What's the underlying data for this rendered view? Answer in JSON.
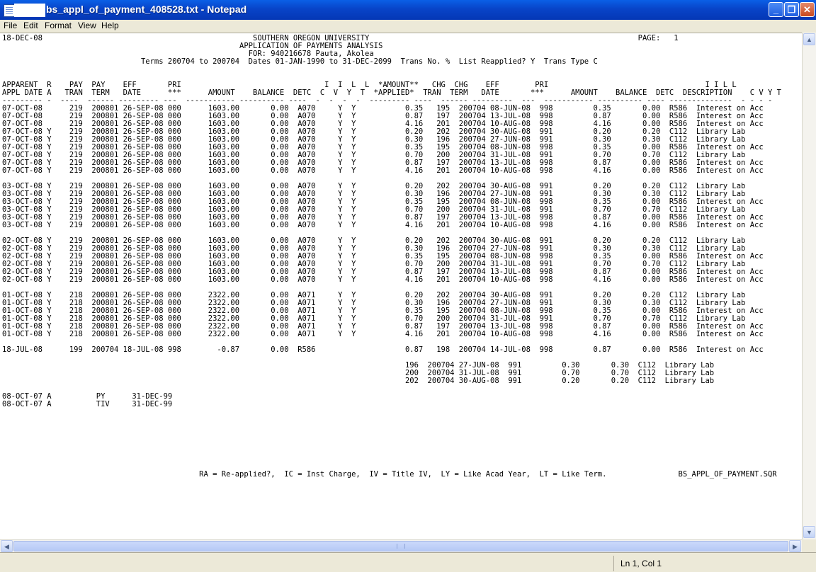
{
  "window": {
    "title": "bs_appl_of_payment_408528.txt - Notepad",
    "minimize_icon": "minimize-icon",
    "maximize_icon": "maximize-icon",
    "close_icon": "close-icon"
  },
  "menu": {
    "file": "File",
    "edit": "Edit",
    "format": "Format",
    "view": "View",
    "help": "Help"
  },
  "document": {
    "lines": [
      "18-DEC-08                                               SOUTHERN OREGON UNIVERSITY                                                            PAGE:   1",
      "                                                     APPLICATION OF PAYMENTS ANALYSIS",
      "                                                       FOR: 940216678 Pauta, Akolea",
      "                               Terms 200704 to 200704  Dates 01-JAN-1990 to 31-DEC-2099  Trans No. %  List Reapplied? Y  Trans Type C",
      "",
      "",
      "APPARENT  R    PAY  PAY    EFF       PRI                                I  I  L  L  *AMOUNT**   CHG  CHG    EFF        PRI                                   I I L L",
      "APPL DATE A   TRAN  TERM   DATE      ***      AMOUNT    BALANCE  DETC  C  V  Y  T  *APPLIED*  TRAN  TERM   DATE       ***      AMOUNT    BALANCE  DETC  DESCRIPTION    C V Y T",
      "--------- -  ----  ------ --------- ---  ----------- ---------- ----  -  -  -  -  --------- ----  ------ ---------  ---  ----------- ---------- ---- --------------  - - - -",
      "07-OCT-08      219  200801 26-SEP-08 000      1603.00       0.00  A070     Y  Y           0.35   195  200704 08-JUN-08  998         0.35       0.00  R586  Interest on Acc",
      "07-OCT-08      219  200801 26-SEP-08 000      1603.00       0.00  A070     Y  Y           0.87   197  200704 13-JUL-08  998         0.87       0.00  R586  Interest on Acc",
      "07-OCT-08      219  200801 26-SEP-08 000      1603.00       0.00  A070     Y  Y           4.16   201  200704 10-AUG-08  998         4.16       0.00  R586  Interest on Acc",
      "07-OCT-08 Y    219  200801 26-SEP-08 000      1603.00       0.00  A070     Y  Y           0.20   202  200704 30-AUG-08  991         0.20       0.20  C112  Library Lab",
      "07-OCT-08 Y    219  200801 26-SEP-08 000      1603.00       0.00  A070     Y  Y           0.30   196  200704 27-JUN-08  991         0.30       0.30  C112  Library Lab",
      "07-OCT-08 Y    219  200801 26-SEP-08 000      1603.00       0.00  A070     Y  Y           0.35   195  200704 08-JUN-08  998         0.35       0.00  R586  Interest on Acc",
      "07-OCT-08 Y    219  200801 26-SEP-08 000      1603.00       0.00  A070     Y  Y           0.70   200  200704 31-JUL-08  991         0.70       0.70  C112  Library Lab",
      "07-OCT-08 Y    219  200801 26-SEP-08 000      1603.00       0.00  A070     Y  Y           0.87   197  200704 13-JUL-08  998         0.87       0.00  R586  Interest on Acc",
      "07-OCT-08 Y    219  200801 26-SEP-08 000      1603.00       0.00  A070     Y  Y           4.16   201  200704 10-AUG-08  998         4.16       0.00  R586  Interest on Acc",
      "",
      "03-OCT-08 Y    219  200801 26-SEP-08 000      1603.00       0.00  A070     Y  Y           0.20   202  200704 30-AUG-08  991         0.20       0.20  C112  Library Lab",
      "03-OCT-08 Y    219  200801 26-SEP-08 000      1603.00       0.00  A070     Y  Y           0.30   196  200704 27-JUN-08  991         0.30       0.30  C112  Library Lab",
      "03-OCT-08 Y    219  200801 26-SEP-08 000      1603.00       0.00  A070     Y  Y           0.35   195  200704 08-JUN-08  998         0.35       0.00  R586  Interest on Acc",
      "03-OCT-08 Y    219  200801 26-SEP-08 000      1603.00       0.00  A070     Y  Y           0.70   200  200704 31-JUL-08  991         0.70       0.70  C112  Library Lab",
      "03-OCT-08 Y    219  200801 26-SEP-08 000      1603.00       0.00  A070     Y  Y           0.87   197  200704 13-JUL-08  998         0.87       0.00  R586  Interest on Acc",
      "03-OCT-08 Y    219  200801 26-SEP-08 000      1603.00       0.00  A070     Y  Y           4.16   201  200704 10-AUG-08  998         4.16       0.00  R586  Interest on Acc",
      "",
      "02-OCT-08 Y    219  200801 26-SEP-08 000      1603.00       0.00  A070     Y  Y           0.20   202  200704 30-AUG-08  991         0.20       0.20  C112  Library Lab",
      "02-OCT-08 Y    219  200801 26-SEP-08 000      1603.00       0.00  A070     Y  Y           0.30   196  200704 27-JUN-08  991         0.30       0.30  C112  Library Lab",
      "02-OCT-08 Y    219  200801 26-SEP-08 000      1603.00       0.00  A070     Y  Y           0.35   195  200704 08-JUN-08  998         0.35       0.00  R586  Interest on Acc",
      "02-OCT-08 Y    219  200801 26-SEP-08 000      1603.00       0.00  A070     Y  Y           0.70   200  200704 31-JUL-08  991         0.70       0.70  C112  Library Lab",
      "02-OCT-08 Y    219  200801 26-SEP-08 000      1603.00       0.00  A070     Y  Y           0.87   197  200704 13-JUL-08  998         0.87       0.00  R586  Interest on Acc",
      "02-OCT-08 Y    219  200801 26-SEP-08 000      1603.00       0.00  A070     Y  Y           4.16   201  200704 10-AUG-08  998         4.16       0.00  R586  Interest on Acc",
      "",
      "01-OCT-08 Y    218  200801 26-SEP-08 000      2322.00       0.00  A071     Y  Y           0.20   202  200704 30-AUG-08  991         0.20       0.20  C112  Library Lab",
      "01-OCT-08 Y    218  200801 26-SEP-08 000      2322.00       0.00  A071     Y  Y           0.30   196  200704 27-JUN-08  991         0.30       0.30  C112  Library Lab",
      "01-OCT-08 Y    218  200801 26-SEP-08 000      2322.00       0.00  A071     Y  Y           0.35   195  200704 08-JUN-08  998         0.35       0.00  R586  Interest on Acc",
      "01-OCT-08 Y    218  200801 26-SEP-08 000      2322.00       0.00  A071     Y  Y           0.70   200  200704 31-JUL-08  991         0.70       0.70  C112  Library Lab",
      "01-OCT-08 Y    218  200801 26-SEP-08 000      2322.00       0.00  A071     Y  Y           0.87   197  200704 13-JUL-08  998         0.87       0.00  R586  Interest on Acc",
      "01-OCT-08 Y    218  200801 26-SEP-08 000      2322.00       0.00  A071     Y  Y           4.16   201  200704 10-AUG-08  998         4.16       0.00  R586  Interest on Acc",
      "",
      "18-JUL-08      199  200704 18-JUL-08 998        -0.87       0.00  R586                    0.87   198  200704 14-JUL-08  998         0.87       0.00  R586  Interest on Acc",
      "",
      "                                                                                          196  200704 27-JUN-08  991         0.30       0.30  C112  Library Lab",
      "                                                                                          200  200704 31-JUL-08  991         0.70       0.70  C112  Library Lab",
      "                                                                                          202  200704 30-AUG-08  991         0.20       0.20  C112  Library Lab",
      "",
      "08-OCT-07 A          PY      31-DEC-99",
      "08-OCT-07 A          TIV     31-DEC-99",
      "",
      "",
      "",
      "",
      "",
      "",
      "",
      "",
      "                                            RA = Re-applied?,  IC = Inst Charge,  IV = Title IV,  LY = Like Acad Year,  LT = Like Term.                BS_APPL_OF_PAYMENT.SQR"
    ]
  },
  "status": {
    "position": "Ln 1, Col 1"
  }
}
